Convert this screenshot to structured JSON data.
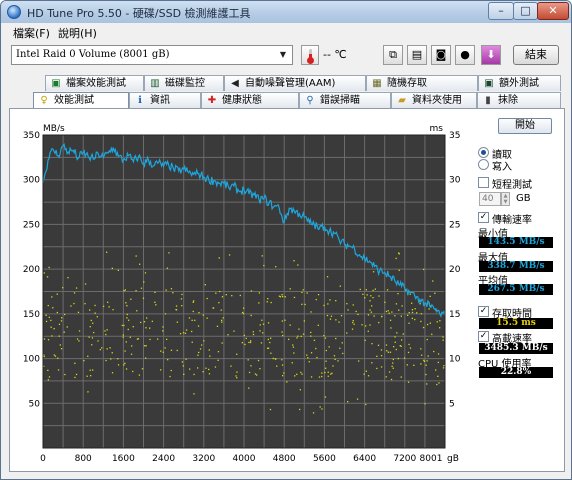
{
  "window": {
    "title": "HD Tune Pro 5.50 - 硬碟/SSD 檢測維護工具",
    "min": "–",
    "max": "□",
    "close": "✕"
  },
  "menu": {
    "file": "檔案(F)",
    "help": "說明(H)"
  },
  "toolbar": {
    "drive": "Intel  Raid 0 Volume (8001 gB)",
    "drive_arrow": "▼",
    "temperature": "-- ℃",
    "exit": "結束",
    "icons": [
      "thermometer-icon",
      "copy-icon",
      "info-icon",
      "camera-icon",
      "coin-icon",
      "download-icon"
    ]
  },
  "tabs_top": [
    {
      "label": "檔案效能測試",
      "icon": "file-benchmark-icon"
    },
    {
      "label": "磁碟監控",
      "icon": "disk-monitor-icon"
    },
    {
      "label": "自動噪聲管理(AAM)",
      "icon": "speaker-icon"
    },
    {
      "label": "隨機存取",
      "icon": "random-access-icon"
    },
    {
      "label": "額外測試",
      "icon": "extra-tests-icon"
    }
  ],
  "tabs_bottom": [
    {
      "label": "效能測試",
      "icon": "benchmark-icon",
      "selected": true
    },
    {
      "label": "資訊",
      "icon": "info-icon"
    },
    {
      "label": "健康狀態",
      "icon": "health-icon"
    },
    {
      "label": "錯誤掃瞄",
      "icon": "error-scan-icon"
    },
    {
      "label": "資料夾使用",
      "icon": "folder-icon"
    },
    {
      "label": "抹除",
      "icon": "erase-icon"
    }
  ],
  "side": {
    "start": "開始",
    "read": "讀取",
    "write": "寫入",
    "short_test": "短程測試",
    "short_size": "40",
    "gb": "GB",
    "transfer_rate": "傳輸速率",
    "min_label": "最小值",
    "min_value": "143.5 MB/s",
    "max_label": "最大值",
    "max_value": "338.7 MB/s",
    "avg_label": "平均值",
    "avg_value": "267.5 MB/s",
    "access_time": "存取時間",
    "access_value": "15.5 ms",
    "burst_rate": "高載速率",
    "burst_value": "3485.3 MB/s",
    "cpu_label": "CPU 使用率",
    "cpu_value": "22.8%"
  },
  "colors": {
    "plot_bg": "#3a3a3a",
    "grid": "#6c6c6c",
    "transfer_line": "#1ea6dc",
    "access_dots": "#d8d810",
    "value_text": "#e8d012",
    "value_bg": "#000000"
  },
  "chart_data": {
    "type": "line",
    "left_unit": "MB/s",
    "right_unit": "ms",
    "x_unit": "gB",
    "ylim_left": [
      0,
      350
    ],
    "ylim_right": [
      0,
      35
    ],
    "xlim": [
      0,
      8001
    ],
    "left_ticks": [
      "350",
      "300",
      "250",
      "200",
      "150",
      "100",
      "50"
    ],
    "right_ticks": [
      "35",
      "30",
      "25",
      "20",
      "15",
      "10",
      "5"
    ],
    "x_ticks": [
      "0",
      "800",
      "1600",
      "2400",
      "3200",
      "4000",
      "4800",
      "5600",
      "6400",
      "7200",
      "8001"
    ],
    "grid": true,
    "series": [
      {
        "name": "傳輸速率",
        "x": [
          0,
          100,
          200,
          300,
          400,
          500,
          600,
          700,
          800,
          900,
          1000,
          1100,
          1200,
          1300,
          1400,
          1500,
          1600,
          1700,
          1800,
          1900,
          2000,
          2100,
          2200,
          2300,
          2400,
          2500,
          2600,
          2700,
          2800,
          2900,
          3000,
          3100,
          3200,
          3300,
          3400,
          3500,
          3600,
          3700,
          3800,
          3900,
          4000,
          4100,
          4200,
          4300,
          4400,
          4500,
          4600,
          4700,
          4800,
          4900,
          5000,
          5100,
          5200,
          5300,
          5400,
          5500,
          5600,
          5700,
          5800,
          5900,
          6000,
          6100,
          6200,
          6300,
          6400,
          6500,
          6600,
          6700,
          6800,
          6900,
          7000,
          7100,
          7200,
          7300,
          7400,
          7500,
          7600,
          7700,
          7800,
          7900,
          8001
        ],
        "values": [
          296,
          322,
          334,
          327,
          338,
          331,
          333,
          324,
          330,
          326,
          323,
          329,
          325,
          330,
          336,
          326,
          322,
          327,
          320,
          326,
          318,
          322,
          316,
          319,
          315,
          317,
          312,
          310,
          312,
          308,
          306,
          307,
          303,
          300,
          299,
          296,
          296,
          291,
          293,
          287,
          289,
          284,
          283,
          278,
          279,
          274,
          270,
          269,
          252,
          268,
          265,
          262,
          258,
          252,
          250,
          245,
          248,
          243,
          240,
          232,
          228,
          226,
          223,
          216,
          212,
          209,
          203,
          198,
          196,
          192,
          187,
          182,
          178,
          174,
          170,
          166,
          162,
          158,
          155,
          150,
          148
        ]
      },
      {
        "name": "存取時間",
        "type": "scatter",
        "value_range_ms": [
          4,
          22
        ],
        "dense_range_ms": [
          8,
          18
        ],
        "point_count": 520
      }
    ]
  }
}
